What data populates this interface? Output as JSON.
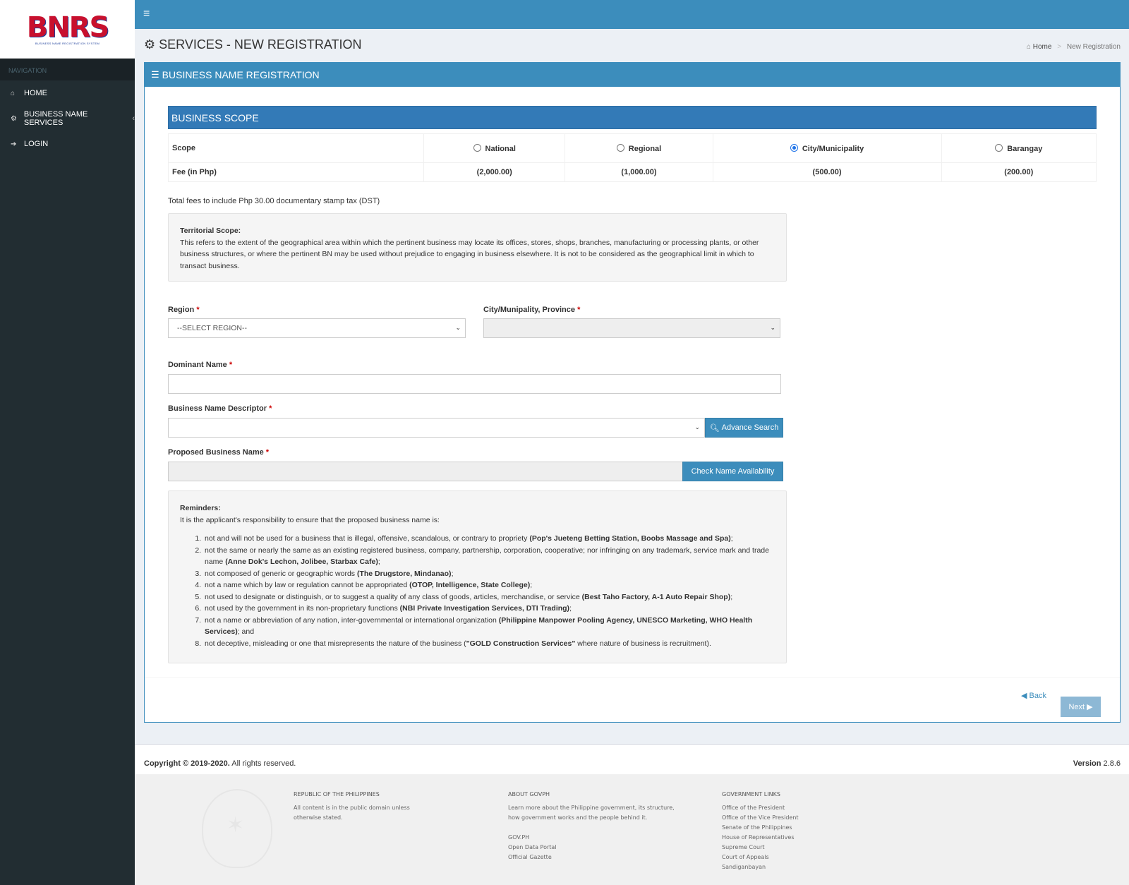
{
  "sidebar": {
    "logo": "BNRS",
    "logo_sub": "BUSINESS NAME REGISTRATION SYSTEM",
    "nav_header": "NAVIGATION",
    "items": [
      {
        "label": "HOME",
        "icon": "home-icon"
      },
      {
        "label": "BUSINESS NAME SERVICES",
        "icon": "gears-icon"
      },
      {
        "label": "LOGIN",
        "icon": "sign-in-icon"
      }
    ]
  },
  "header": {
    "page_title": "SERVICES - NEW REGISTRATION",
    "breadcrumb": {
      "home": "Home",
      "current": "New Registration"
    }
  },
  "box": {
    "title": "BUSINESS NAME REGISTRATION",
    "scope_title": "BUSINESS SCOPE",
    "scope_row_label": "Scope",
    "fee_row_label": "Fee (in Php)",
    "scopes": [
      {
        "label": "National",
        "fee": "(2,000.00)",
        "selected": false
      },
      {
        "label": "Regional",
        "fee": "(1,000.00)",
        "selected": false
      },
      {
        "label": "City/Municipality",
        "fee": "(500.00)",
        "selected": true
      },
      {
        "label": "Barangay",
        "fee": "(200.00)",
        "selected": false
      }
    ],
    "dst_note": "Total fees to include Php 30.00 documentary stamp tax (DST)",
    "territorial": {
      "title": "Territorial Scope:",
      "text": "This refers to the extent of the geographical area within which the pertinent business may locate its offices, stores, shops, branches, manufacturing or processing plants, or other business structures, or where the pertinent BN may be used without prejudice to engaging in business elsewhere. It is not to be considered as the geographical limit in which to transact business."
    }
  },
  "form": {
    "region_label": "Region",
    "region_value": "--SELECT REGION--",
    "city_label": "City/Munipality, Province",
    "city_value": "",
    "dominant_label": "Dominant Name",
    "dominant_value": "",
    "descriptor_label": "Business Name Descriptor",
    "descriptor_value": "",
    "advance_search": "Advance Search",
    "proposed_label": "Proposed Business Name",
    "proposed_value": "",
    "check_button": "Check Name Availability",
    "required_mark": "*"
  },
  "reminders": {
    "title": "Reminders:",
    "intro": "It is the applicant's responsibility to ensure that the proposed business name is:",
    "items": [
      {
        "text": "not and will not be used for a business that is illegal, offensive, scandalous, or contrary to propriety ",
        "bold": "(Pop's Jueteng Betting Station, Boobs Massage and Spa)",
        "tail": ";"
      },
      {
        "text": "not the same or nearly the same as an existing registered business, company, partnership, corporation, cooperative; nor infringing on any trademark, service mark and trade name ",
        "bold": "(Anne Dok's Lechon, Jolibee, Starbax Cafe)",
        "tail": ";"
      },
      {
        "text": "not composed of generic or geographic words ",
        "bold": "(The Drugstore, Mindanao)",
        "tail": ";"
      },
      {
        "text": "not a name which by law or regulation cannot be appropriated ",
        "bold": "(OTOP, Intelligence, State College)",
        "tail": ";"
      },
      {
        "text": "not used to designate or distinguish, or to suggest a quality of any class of goods, articles, merchandise, or service ",
        "bold": "(Best Taho Factory, A-1 Auto Repair Shop)",
        "tail": ";"
      },
      {
        "text": "not used by the government in its non-proprietary functions ",
        "bold": "(NBI Private Investigation Services, DTI Trading)",
        "tail": ";"
      },
      {
        "text": "not a name or abbreviation of any nation, inter-governmental or international organization ",
        "bold": "(Philippine Manpower Pooling Agency, UNESCO Marketing, WHO Health Services)",
        "tail": "; and"
      },
      {
        "text": "not deceptive, misleading or one that misrepresents the nature of the business (",
        "bold": "\"GOLD Construction Services\"",
        "tail": " where nature of business is recruitment)."
      }
    ]
  },
  "footer_buttons": {
    "back": "Back",
    "next": "Next"
  },
  "copyright": {
    "bold": "Copyright © 2019-2020.",
    "rest": " All rights reserved.",
    "version_label": "Version",
    "version": "2.8.6"
  },
  "gov_footer": {
    "col1": {
      "title": "REPUBLIC OF THE PHILIPPINES",
      "text": "All content is in the public domain unless otherwise stated."
    },
    "col2": {
      "title": "ABOUT GOVPH",
      "text": "Learn more about the Philippine government, its structure, how government works and the people behind it.",
      "links": [
        "GOV.PH",
        "Open Data Portal",
        "Official Gazette"
      ]
    },
    "col3": {
      "title": "GOVERNMENT LINKS",
      "links": [
        "Office of the President",
        "Office of the Vice President",
        "Senate of the Philippines",
        "House of Representatives",
        "Supreme Court",
        "Court of Appeals",
        "Sandiganbayan"
      ]
    }
  }
}
